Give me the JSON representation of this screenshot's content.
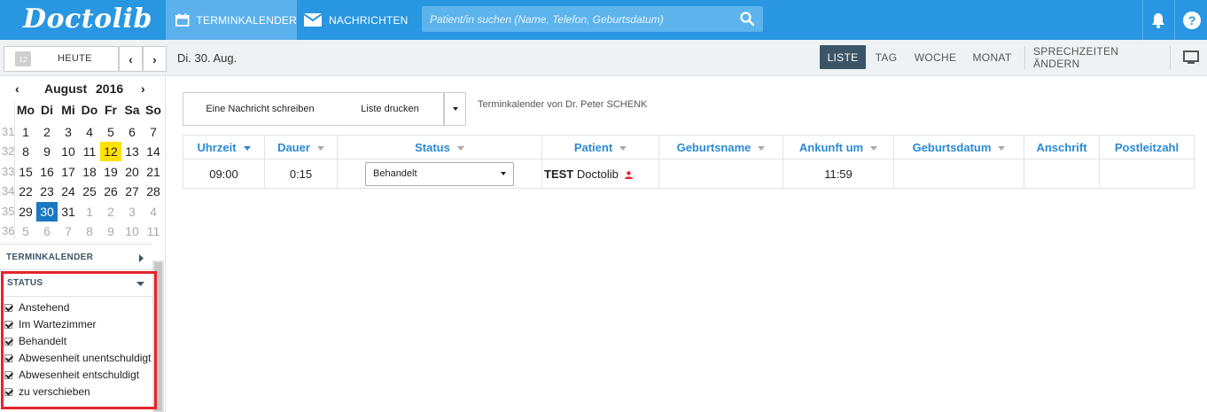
{
  "app": {
    "logo": "Doctolib"
  },
  "nav": {
    "calendar_tab": "TERMINKALENDER",
    "messages_tab": "NACHRICHTEN",
    "search_placeholder": "Patient/in suchen (Name, Telefon, Geburtsdatum)"
  },
  "toolbar": {
    "calendar_icon_day": "12",
    "today_label": "HEUTE",
    "prev_symbol": "‹",
    "next_symbol": "›",
    "current_date": "Di. 30. Aug.",
    "views": [
      "LISTE",
      "TAG",
      "WOCHE",
      "MONAT"
    ],
    "active_view": "LISTE",
    "edit_hours": "SPRECHZEITEN ÄNDERN"
  },
  "mini_calendar": {
    "month": "August",
    "year": "2016",
    "prev": "‹",
    "next": "›",
    "weekdays": [
      "Mo",
      "Di",
      "Mi",
      "Do",
      "Fr",
      "Sa",
      "So"
    ],
    "weeks": [
      {
        "num": "31",
        "days": [
          "1",
          "2",
          "3",
          "4",
          "5",
          "6",
          "7"
        ]
      },
      {
        "num": "32",
        "days": [
          "8",
          "9",
          "10",
          "11",
          "12",
          "13",
          "14"
        ]
      },
      {
        "num": "33",
        "days": [
          "15",
          "16",
          "17",
          "18",
          "19",
          "20",
          "21"
        ]
      },
      {
        "num": "34",
        "days": [
          "22",
          "23",
          "24",
          "25",
          "26",
          "27",
          "28"
        ]
      },
      {
        "num": "35",
        "days": [
          "29",
          "30",
          "31",
          "1",
          "2",
          "3",
          "4"
        ]
      },
      {
        "num": "36",
        "days": [
          "5",
          "6",
          "7",
          "8",
          "9",
          "10",
          "11"
        ]
      }
    ],
    "holiday": "12",
    "selected": "30",
    "colors": {
      "holiday": "#ffe100",
      "selected": "#1a78c2"
    }
  },
  "sidebar": {
    "calendar_section": "TERMINKALENDER",
    "status_section": "STATUS",
    "status_items": [
      "Anstehend",
      "Im Wartezimmer",
      "Behandelt",
      "Abwesenheit unentschuldigt",
      "Abwesenheit entschuldigt",
      "zu verschieben"
    ]
  },
  "main": {
    "write_message": "Eine Nachricht schreiben",
    "print_list": "Liste drucken",
    "calendar_owner": "Terminkalender von Dr. Peter SCHENK",
    "columns": [
      "Uhrzeit",
      "Dauer",
      "Status",
      "Patient",
      "Geburtsname",
      "Ankunft um",
      "Geburtsdatum",
      "Anschrift",
      "Postleitzahl"
    ],
    "row": {
      "time": "09:00",
      "duration": "0:15",
      "status": "Behandelt",
      "patient_last": "TEST",
      "patient_first": "Doctolib",
      "birth_name": "",
      "arrival": "11:59",
      "birth_date": "",
      "address": "",
      "postal_code": ""
    }
  },
  "colors": {
    "brand": "#2896e0",
    "accent": "#2a8ad6",
    "highlight_box": "#e5232c",
    "active_view": "#3c5566"
  }
}
